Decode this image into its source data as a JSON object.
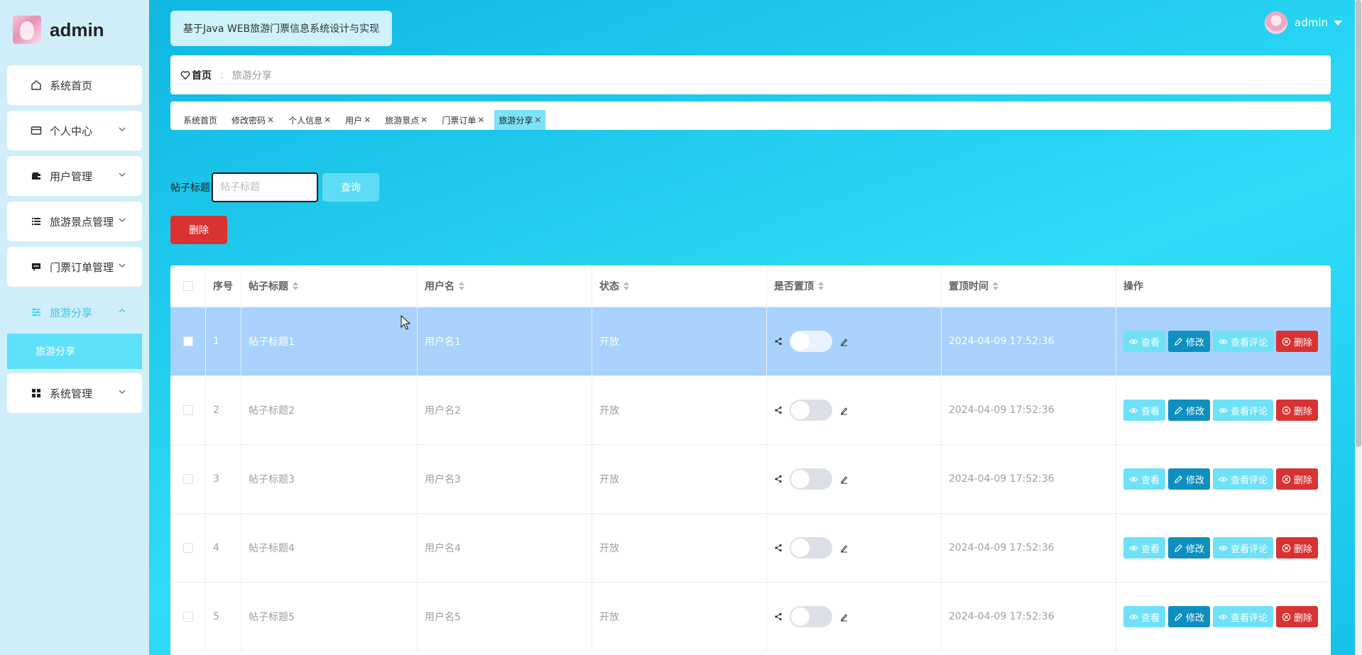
{
  "sidebar": {
    "brand": "admin",
    "items": [
      {
        "label": "系统首页",
        "icon": "home-icon"
      },
      {
        "label": "个人中心",
        "icon": "card-icon"
      },
      {
        "label": "用户管理",
        "icon": "wallet-icon"
      },
      {
        "label": "旅游景点管理",
        "icon": "list-icon"
      },
      {
        "label": "门票订单管理",
        "icon": "message-icon"
      },
      {
        "label": "旅游分享",
        "icon": "sliders-icon"
      },
      {
        "label": "系统管理",
        "icon": "grid-icon"
      }
    ],
    "submenu": {
      "label": "旅游分享"
    }
  },
  "header": {
    "app_title": "基于Java WEB旅游门票信息系统设计与实现",
    "user": "admin"
  },
  "breadcrumb": {
    "home": "首页",
    "separator": ":",
    "current": "旅游分享"
  },
  "tabs": [
    {
      "label": "系统首页",
      "closable": false
    },
    {
      "label": "修改密码",
      "closable": true
    },
    {
      "label": "个人信息",
      "closable": true
    },
    {
      "label": "用户",
      "closable": true
    },
    {
      "label": "旅游景点",
      "closable": true
    },
    {
      "label": "门票订单",
      "closable": true
    },
    {
      "label": "旅游分享",
      "closable": true,
      "active": true
    }
  ],
  "search": {
    "label": "帖子标题",
    "placeholder": "帖子标题",
    "button": "查询"
  },
  "batch_delete": "删除",
  "table": {
    "columns": [
      "序号",
      "帖子标题",
      "用户名",
      "状态",
      "是否置顶",
      "置顶时间",
      "操作"
    ],
    "rows": [
      {
        "index": "1",
        "title": "帖子标题1",
        "user": "用户名1",
        "status": "开放",
        "time": "2024-04-09 17:52:36",
        "selected": true
      },
      {
        "index": "2",
        "title": "帖子标题2",
        "user": "用户名2",
        "status": "开放",
        "time": "2024-04-09 17:52:36"
      },
      {
        "index": "3",
        "title": "帖子标题3",
        "user": "用户名3",
        "status": "开放",
        "time": "2024-04-09 17:52:36"
      },
      {
        "index": "4",
        "title": "帖子标题4",
        "user": "用户名4",
        "status": "开放",
        "time": "2024-04-09 17:52:36"
      },
      {
        "index": "5",
        "title": "帖子标题5",
        "user": "用户名5",
        "status": "开放",
        "time": "2024-04-09 17:52:36"
      }
    ],
    "actions": {
      "view": "查看",
      "edit": "修改",
      "comments": "查看评论",
      "delete": "删除"
    }
  },
  "colors": {
    "sidebar_bg": "#cfeefa",
    "accent": "#36c6e8",
    "danger": "#d93232",
    "edit": "#0e8fc0",
    "selected_row": "#a8d2fb"
  }
}
